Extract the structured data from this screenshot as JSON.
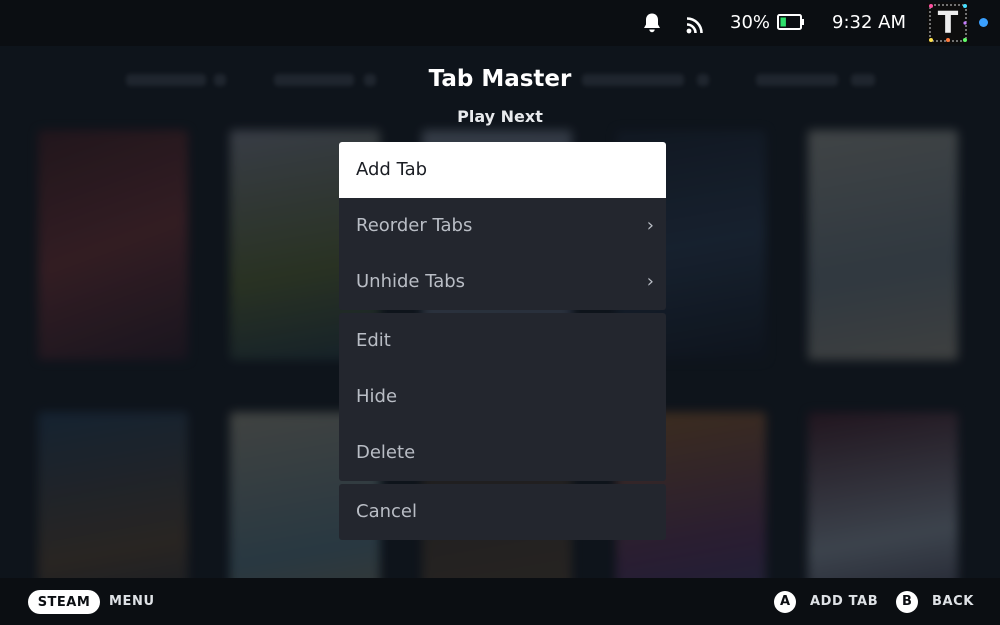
{
  "status_bar": {
    "battery_percent": "30%",
    "battery_level": 0.3,
    "time": "9:32 AM",
    "icons": [
      "bell-icon",
      "wifi-icon",
      "battery-icon"
    ],
    "avatar_letter": "T",
    "online_color": "#3aa0ff"
  },
  "dialog": {
    "title": "Tab Master",
    "subtitle": "Play Next"
  },
  "menu": {
    "groups": [
      {
        "items": [
          {
            "label": "Add Tab",
            "focused": true
          },
          {
            "label": "Reorder Tabs",
            "has_submenu": true,
            "chevron": "›"
          },
          {
            "label": "Unhide Tabs",
            "has_submenu": true,
            "chevron": "›"
          }
        ]
      },
      {
        "items": [
          {
            "label": "Edit"
          },
          {
            "label": "Hide"
          },
          {
            "label": "Delete"
          }
        ]
      },
      {
        "items": [
          {
            "label": "Cancel"
          }
        ]
      }
    ]
  },
  "footer": {
    "steam_label": "STEAM",
    "menu_label": "MENU",
    "a_glyph": "A",
    "a_label": "ADD TAB",
    "b_glyph": "B",
    "b_label": "BACK"
  },
  "colors": {
    "menu_bg": "#23262e",
    "focus_bg": "#ffffff",
    "text_muted": "#b9bdc5",
    "bar_bg": "#0b0e12"
  }
}
